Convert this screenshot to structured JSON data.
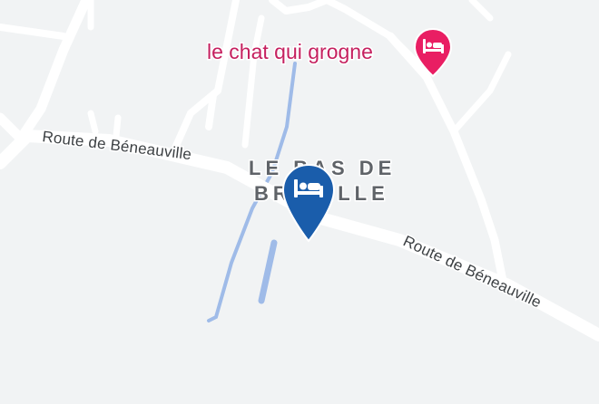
{
  "map": {
    "background_color": "#f1f3f4",
    "road_color": "#ffffff",
    "water_color": "#9fbbe8",
    "roads": {
      "main_road_west_label": "Route de Béneauville",
      "main_road_east_label": "Route de Béneauville"
    },
    "place": {
      "line1": "LE BAS DE",
      "line2": "BREVILLE"
    },
    "poi": {
      "name": "le chat qui grogne",
      "icon": "hotel-bed-icon",
      "color": "#e91e63"
    },
    "selected_marker": {
      "icon": "hotel-bed-icon",
      "color": "#1a5dab"
    }
  }
}
